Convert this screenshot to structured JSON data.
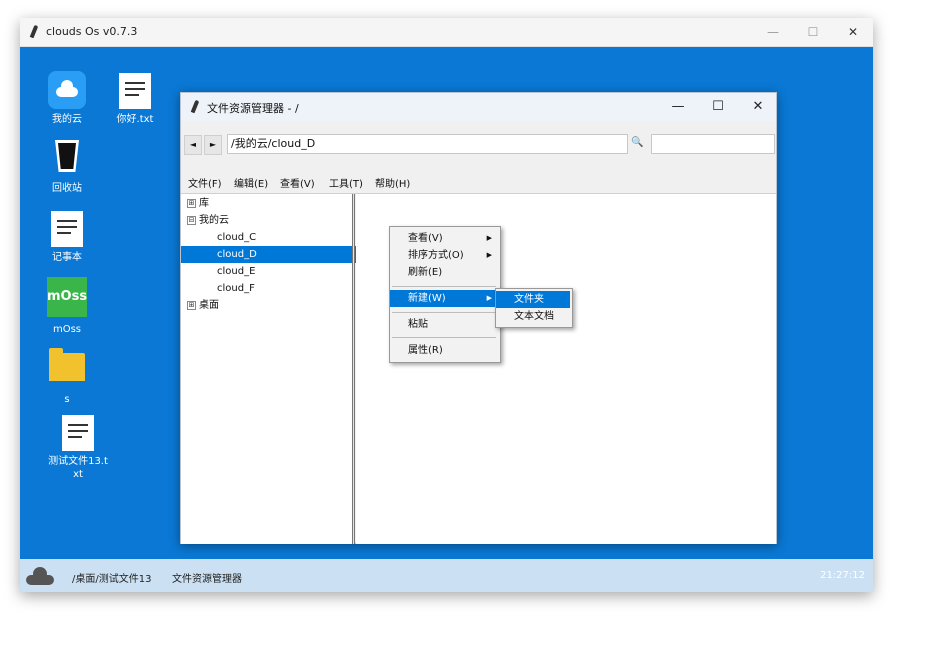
{
  "outer_window": {
    "title": "clouds Os v0.7.3",
    "controls": {
      "minimize": "—",
      "maximize": "☐",
      "close": "✕"
    }
  },
  "desktop": {
    "icons": [
      {
        "label": "我的云",
        "icon": "cloud-app-icon"
      },
      {
        "label": "回收站",
        "icon": "recycle-bin-icon"
      },
      {
        "label": "记事本",
        "icon": "notepad-icon"
      },
      {
        "label": "mOss",
        "icon": "moss-app-icon"
      },
      {
        "label": "s",
        "icon": "folder-icon"
      },
      {
        "label": "测试文件13.t\nxt",
        "icon": "text-file-icon"
      },
      {
        "label": "你好.txt",
        "icon": "text-file-icon"
      }
    ],
    "moss_tile_text": "mOss"
  },
  "explorer": {
    "title": "文件资源管理器 - /",
    "controls": {
      "minimize": "—",
      "maximize": "☐",
      "close": "✕"
    },
    "nav": {
      "back": "◄",
      "forward": "►"
    },
    "address": "/我的云/cloud_D",
    "search_icon": "🔍",
    "search_value": "",
    "menu": [
      "文件(F)",
      "编辑(E)",
      "查看(V)",
      "工具(T)",
      "帮助(H)"
    ],
    "tree": [
      {
        "label": "库",
        "expander": "⊞"
      },
      {
        "label": "我的云",
        "expander": "⊟"
      },
      {
        "label": "cloud_C",
        "expander": ""
      },
      {
        "label": "cloud_D",
        "expander": "",
        "selected": true
      },
      {
        "label": "cloud_E",
        "expander": ""
      },
      {
        "label": "cloud_F",
        "expander": ""
      },
      {
        "label": "桌面",
        "expander": "⊞"
      }
    ]
  },
  "context_menu": {
    "items": [
      "查看(V)",
      "排序方式(O)",
      "刷新(E)",
      "新建(W)",
      "粘贴",
      "属性(R)"
    ],
    "highlighted": "新建(W)",
    "arrow": "▶"
  },
  "submenu": {
    "items": [
      "文件夹",
      "文本文档"
    ],
    "highlighted": "文件夹"
  },
  "taskbar": {
    "path": "/桌面/测试文件13",
    "app": "文件资源管理器",
    "time": "21:27:12"
  },
  "colors": {
    "desktop_bg": "#0a78d4",
    "selection": "#0078d7",
    "taskbar_bg": "#cbe0f3",
    "moss_green": "#39b54a",
    "folder_yellow": "#f2c12e"
  }
}
